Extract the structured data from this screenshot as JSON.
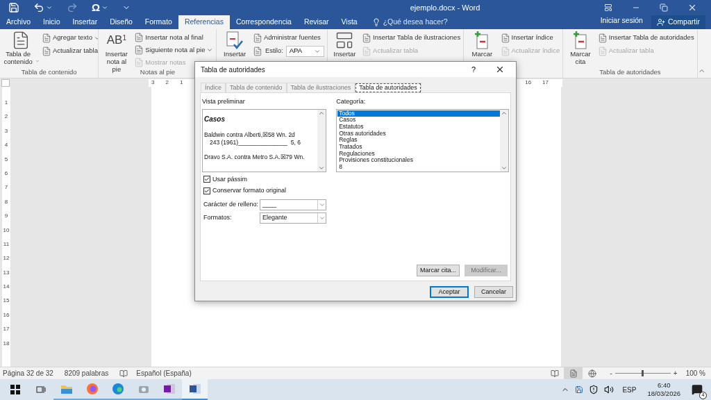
{
  "window": {
    "title": "ejemplo.docx - Word"
  },
  "quick_access": [
    {
      "kind": "save",
      "disabled": false
    },
    {
      "kind": "undo",
      "disabled": false
    },
    {
      "kind": "redo",
      "disabled": true
    },
    {
      "kind": "symbol",
      "disabled": false
    },
    {
      "kind": "customize",
      "disabled": false
    }
  ],
  "symbol_glyph": "Ω",
  "tabs": [
    {
      "label": "Archivo",
      "selected": false
    },
    {
      "label": "Inicio",
      "selected": false
    },
    {
      "label": "Insertar",
      "selected": false
    },
    {
      "label": "Diseño",
      "selected": false
    },
    {
      "label": "Formato",
      "selected": false
    },
    {
      "label": "Referencias",
      "selected": true
    },
    {
      "label": "Correspondencia",
      "selected": false
    },
    {
      "label": "Revisar",
      "selected": false
    },
    {
      "label": "Vista",
      "selected": false
    }
  ],
  "tell_me": {
    "placeholder": "¿Qué desea hacer?"
  },
  "sign_in": "Iniciar sesión",
  "share": "Compartir",
  "ribbon_groups": [
    {
      "label": "Tabla de contenido",
      "big": {
        "kind": "toc",
        "label": "Tabla de contenido",
        "dropdown": true
      },
      "items": [
        {
          "kind": "button",
          "label": "Agregar texto",
          "dropdown": true,
          "disabled": false
        },
        {
          "kind": "button",
          "label": "Actualizar tabla",
          "disabled": false
        }
      ]
    },
    {
      "label": "Notas al pie",
      "big": {
        "kind": "footnote",
        "glyph": "AB$^{1}$",
        "label": "Insertar nota al pie"
      },
      "items": [
        {
          "kind": "button",
          "label": "Insertar nota al final",
          "disabled": false
        },
        {
          "kind": "button",
          "label": "Siguiente nota al pie",
          "dropdown": true,
          "disabled": false
        },
        {
          "kind": "button",
          "label": "Mostrar notas",
          "disabled": true
        }
      ]
    },
    {
      "big": {
        "kind": "citation",
        "label": "Insertar"
      },
      "items": [
        {
          "kind": "button",
          "label": "Administrar fuentes",
          "disabled": false
        },
        {
          "kind": "select",
          "label": "Estilo:",
          "value": "APA"
        }
      ]
    },
    {
      "big": {
        "kind": "caption",
        "label": "Insertar"
      },
      "items": [
        {
          "kind": "button",
          "label": "Insertar Tabla de ilustraciones",
          "disabled": false
        },
        {
          "kind": "button",
          "label": "Actualizar tabla",
          "disabled": true
        }
      ]
    },
    {
      "big": {
        "kind": "mark",
        "label": "Marcar"
      },
      "items": [
        {
          "kind": "button",
          "label": "Insertar índice",
          "disabled": false
        },
        {
          "kind": "button",
          "label": "Actualizar índice",
          "disabled": true
        }
      ]
    },
    {
      "label": "Tabla de autoridades",
      "big": {
        "kind": "mark",
        "label": "Marcar cita"
      },
      "items": [
        {
          "kind": "button",
          "label": "Insertar Tabla de autoridades",
          "disabled": false
        },
        {
          "kind": "button",
          "label": "Actualizar tabla",
          "disabled": true
        }
      ]
    }
  ],
  "ruler": {
    "left_labels": [
      "3",
      "2",
      "1"
    ],
    "right_labels": [
      "16",
      "17"
    ],
    "vertical_labels": [
      "1",
      "2",
      "3",
      "4",
      "5",
      "6",
      "7",
      "8",
      "9",
      "10",
      "11",
      "12",
      "13",
      "14",
      "15",
      "16",
      "17",
      "18"
    ]
  },
  "dialog": {
    "title": "Tabla de autoridades",
    "help": "?",
    "tabs": [
      {
        "label": "Índice",
        "selected": false
      },
      {
        "label": "Tabla de contenido",
        "selected": false
      },
      {
        "label": "Tabla de ilustraciones",
        "selected": false
      },
      {
        "label": "Tabla de autoridades",
        "selected": true
      }
    ],
    "preview_label": "Vista preliminar",
    "preview": [
      {
        "kind": "heading",
        "text": "Casos"
      },
      {
        "kind": "entry",
        "text": "Baldwin contra Alberti,☒58 Wn. 2d"
      },
      {
        "kind": "continuation",
        "text": "243 (1961)_______________  5, 6"
      },
      {
        "kind": "entry",
        "text": "Dravo S.A. contra Metro S.A.☒79 Wn."
      }
    ],
    "category_label": "Categoría:",
    "categories": [
      {
        "label": "Todos",
        "selected": true
      },
      {
        "label": "Casos",
        "selected": false
      },
      {
        "label": "Estatutos",
        "selected": false
      },
      {
        "label": "Otras autoridades",
        "selected": false
      },
      {
        "label": "Reglas",
        "selected": false
      },
      {
        "label": "Tratados",
        "selected": false
      },
      {
        "label": "Regulaciones",
        "selected": false
      },
      {
        "label": "Provisiones constitucionales",
        "selected": false
      },
      {
        "label": "8",
        "selected": false
      }
    ],
    "checkboxes": [
      {
        "label": "Usar pássim",
        "checked": true
      },
      {
        "label": "Conservar formato original",
        "checked": true
      }
    ],
    "fields": [
      {
        "label": "Carácter de relleno:",
        "value": "____"
      },
      {
        "label": "Formatos:",
        "value": "Elegante"
      }
    ],
    "panel_buttons": [
      {
        "label": "Marcar cita...",
        "disabled": false
      },
      {
        "label": "Modificar...",
        "disabled": true
      }
    ],
    "buttons": [
      {
        "label": "Aceptar",
        "default": true
      },
      {
        "label": "Cancelar",
        "default": false
      }
    ]
  },
  "status_bar": {
    "page": "Página 32 de 32",
    "words": "8209 palabras",
    "language": "Español (España)",
    "views": [
      {
        "kind": "read",
        "selected": false
      },
      {
        "kind": "print",
        "selected": true
      },
      {
        "kind": "web",
        "selected": false
      }
    ],
    "zoom_out": "-",
    "zoom_in": "+",
    "zoom": {
      "level": 0.5
    },
    "zoom_label": "100 %"
  },
  "taskbar": {
    "apps": [
      {
        "kind": "start"
      },
      {
        "kind": "taskview"
      },
      {
        "kind": "folder",
        "active": false
      },
      {
        "kind": "firefox",
        "active": false
      },
      {
        "kind": "edge",
        "active": false
      },
      {
        "kind": "camera",
        "active": false
      },
      {
        "kind": "onenote",
        "active": false
      },
      {
        "kind": "word",
        "active": true
      }
    ],
    "language": "ESP",
    "time": "6:40",
    "date": "18/03/2026",
    "notifications": "4"
  }
}
